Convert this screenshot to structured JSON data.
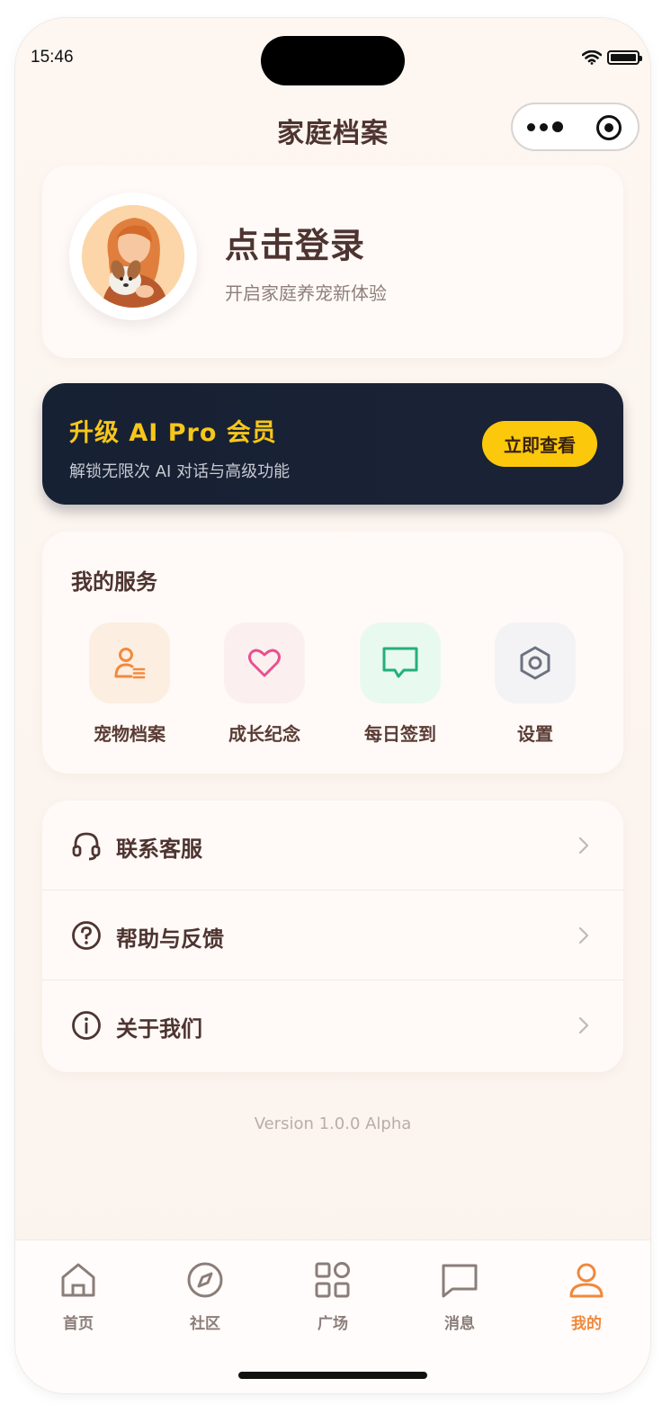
{
  "status_bar": {
    "time": "15:46"
  },
  "nav": {
    "title": "家庭档案"
  },
  "profile": {
    "title": "点击登录",
    "subtitle": "开启家庭养宠新体验"
  },
  "pro_banner": {
    "title": "升级 AI Pro 会员",
    "subtitle": "解锁无限次 AI 对话与高级功能",
    "button": "立即查看"
  },
  "services": {
    "title": "我的服务",
    "items": [
      {
        "label": "宠物档案",
        "icon": "pet-profile-icon",
        "color": "#f28a3c",
        "bg": "#fdeee2"
      },
      {
        "label": "成长纪念",
        "icon": "heart-icon",
        "color": "#e8518f",
        "bg": "#fbf0ef"
      },
      {
        "label": "每日签到",
        "icon": "message-square-icon",
        "color": "#22b07a",
        "bg": "#e8f9f0"
      },
      {
        "label": "设置",
        "icon": "hexagon-settings-icon",
        "color": "#6b7280",
        "bg": "#f3f3f5"
      }
    ]
  },
  "menu": {
    "items": [
      {
        "label": "联系客服",
        "icon": "headset-icon"
      },
      {
        "label": "帮助与反馈",
        "icon": "help-circle-icon"
      },
      {
        "label": "关于我们",
        "icon": "info-circle-icon"
      }
    ]
  },
  "version": "Version 1.0.0 Alpha",
  "tabbar": {
    "items": [
      {
        "label": "首页",
        "icon": "home-icon",
        "active": false
      },
      {
        "label": "社区",
        "icon": "compass-icon",
        "active": false
      },
      {
        "label": "广场",
        "icon": "apps-grid-icon",
        "active": false
      },
      {
        "label": "消息",
        "icon": "chat-icon",
        "active": false
      },
      {
        "label": "我的",
        "icon": "user-icon",
        "active": true
      }
    ],
    "active_color": "#f0883b",
    "inactive_color": "#8b7d78"
  }
}
